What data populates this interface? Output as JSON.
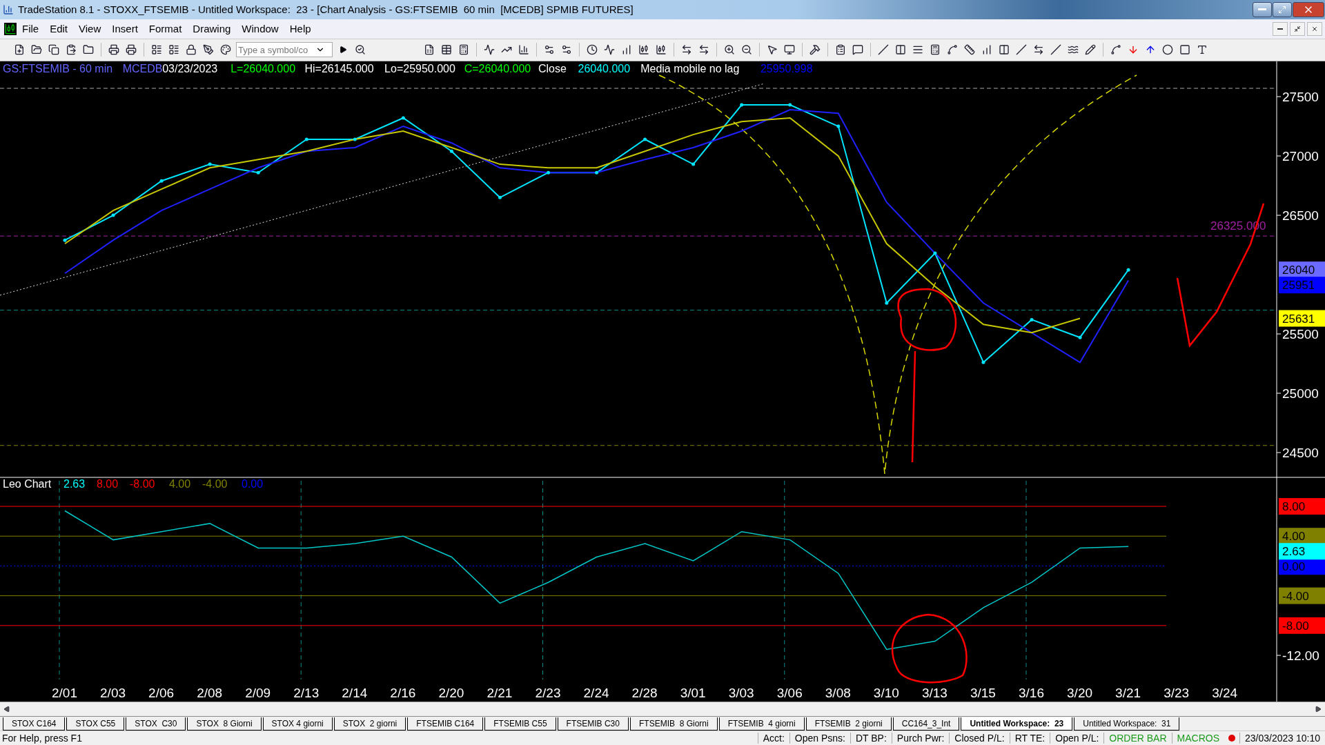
{
  "window": {
    "title": "TradeStation 8.1 - STOXX_FTSEMIB - Untitled Workspace:  23 - [Chart Analysis - GS:FTSEMIB  60 min  [MCEDB] SPMIB FUTURES]"
  },
  "menu": [
    "File",
    "Edit",
    "View",
    "Insert",
    "Format",
    "Drawing",
    "Window",
    "Help"
  ],
  "toolbar": {
    "symbol_field": {
      "placeholder": "Type a symbol/co"
    }
  },
  "chart": {
    "header": [
      {
        "text": "GS:FTSEMIB - 60 min",
        "color": "#6464ff"
      },
      {
        "text": "MCEDB",
        "color": "#6464ff"
      },
      {
        "text": "03/23/2023",
        "color": "#ffffff"
      },
      {
        "text": "L=26040.000",
        "color": "#00ff00"
      },
      {
        "text": "Hi=26145.000",
        "color": "#ffffff"
      },
      {
        "text": "Lo=25950.000",
        "color": "#ffffff"
      },
      {
        "text": "C=26040.000",
        "color": "#00ff00"
      },
      {
        "text": "Close",
        "color": "#ffffff"
      },
      {
        "text": "26040.000",
        "color": "#00ffff"
      },
      {
        "text": "Media mobile no lag",
        "color": "#ffffff"
      },
      {
        "text": "25950.998",
        "color": "#0000ff"
      }
    ],
    "price_panel": {
      "chart_data": {
        "type": "line",
        "ylim": [
          24291,
          27797
        ],
        "yticks": [
          24500,
          25000,
          25500,
          26500,
          27000,
          27500
        ],
        "series": [
          {
            "color": "#00e5ff",
            "values": [
              26290,
              26500,
              26790,
              26930,
              26860,
              27140,
              27140,
              27320,
              27040,
              26650,
              26860,
              26860,
              27140,
              26930,
              27430,
              27430,
              27250,
              25760,
              26180,
              25260,
              25620,
              25470,
              26040,
              null,
              null
            ]
          },
          {
            "color": "#2020ff",
            "values": [
              26010,
              26290,
              26540,
              26720,
              26900,
              27040,
              27070,
              27250,
              27110,
              26900,
              26860,
              26860,
              26970,
              27070,
              27210,
              27390,
              27360,
              26610,
              26180,
              25760,
              25510,
              25260,
              25951,
              null,
              null
            ]
          },
          {
            "color": "#c8c800",
            "values": [
              26260,
              26540,
              26720,
              26900,
              26970,
              27040,
              27140,
              27210,
              27070,
              26930,
              26900,
              26900,
              27040,
              27180,
              27290,
              27320,
              27000,
              26260,
              25900,
              25580,
              25510,
              25631,
              null,
              null,
              null
            ]
          }
        ],
        "ref_lines": [
          {
            "axis": "y",
            "value": 27570,
            "color": "#aaaaaa"
          },
          {
            "axis": "y",
            "value": 26325,
            "color": "#a020a0",
            "label": "26325.000"
          },
          {
            "axis": "y",
            "value": 25700,
            "color": "#0a8a8a"
          },
          {
            "axis": "y",
            "value": 24560,
            "color": "#808000"
          }
        ]
      },
      "value_tags": [
        {
          "text": "26040",
          "color": "#6b6bff"
        },
        {
          "text": "25951",
          "color": "#0000ff"
        },
        {
          "text": "25631",
          "color": "#ffff00"
        }
      ]
    },
    "indicator_panel": {
      "title": "Leo Chart",
      "values": [
        {
          "text": "2.63",
          "color": "#00ffff"
        },
        {
          "text": "8.00",
          "color": "#ff0000"
        },
        {
          "text": "-8.00",
          "color": "#ff0000"
        },
        {
          "text": "4.00",
          "color": "#808000"
        },
        {
          "text": "-4.00",
          "color": "#808000"
        },
        {
          "text": "0.00",
          "color": "#0000ff"
        }
      ],
      "chart_data": {
        "type": "line",
        "grid": true,
        "categories": [
          "2/01",
          "2/03",
          "2/06",
          "2/08",
          "2/09",
          "2/13",
          "2/14",
          "2/16",
          "2/20",
          "2/21",
          "2/23",
          "2/24",
          "2/28",
          "3/01",
          "3/03",
          "3/06",
          "3/08",
          "3/10",
          "3/13",
          "3/15",
          "3/16",
          "3/20",
          "3/21",
          "3/23",
          "3/24"
        ],
        "ylim": [
          -18.2,
          11.89
        ],
        "yticks": [
          {
            "value": 8,
            "label": "8.00"
          },
          {
            "value": 4,
            "label": "4.00"
          },
          {
            "value": 0,
            "label": "0.00"
          },
          {
            "value": -4,
            "label": "-4.00"
          },
          {
            "value": -8,
            "label": "-8.00"
          },
          {
            "value": -12,
            "label": "-12.00"
          }
        ],
        "series": [
          {
            "color": "#00c8c8",
            "values": [
              7.4,
              3.5,
              4.6,
              5.7,
              2.4,
              2.4,
              3.0,
              4.0,
              1.2,
              -5.0,
              -2.2,
              1.2,
              3.0,
              0.7,
              4.6,
              3.5,
              -1.0,
              -11.2,
              -10.1,
              -5.6,
              -2.2,
              2.4,
              2.6,
              null,
              null
            ]
          }
        ],
        "ref_lines": [
          {
            "axis": "y",
            "value": 8,
            "color": "#ff0000"
          },
          {
            "axis": "y",
            "value": 4,
            "color": "#808000"
          },
          {
            "axis": "y",
            "value": 0,
            "color": "#0000ff"
          },
          {
            "axis": "y",
            "value": -4,
            "color": "#808000"
          },
          {
            "axis": "y",
            "value": -8,
            "color": "#ff0000"
          }
        ]
      },
      "value_tags": [
        {
          "text": "2.63",
          "color": "#00ffff"
        }
      ]
    }
  },
  "workspace_tabs": [
    {
      "label": "STOX C164",
      "selected": false
    },
    {
      "label": "STOX C55",
      "selected": false
    },
    {
      "label": "STOX  C30",
      "selected": false
    },
    {
      "label": "STOX  8 Giorni",
      "selected": false
    },
    {
      "label": "STOX 4 giorni",
      "selected": false
    },
    {
      "label": "STOX  2 giorni",
      "selected": false
    },
    {
      "label": "FTSEMIB C164",
      "selected": false
    },
    {
      "label": "FTSEMIB C55",
      "selected": false
    },
    {
      "label": "FTSEMIB C30",
      "selected": false
    },
    {
      "label": "FTSEMIB  8 Giorni",
      "selected": false
    },
    {
      "label": "FTSEMIB  4 giorni",
      "selected": false
    },
    {
      "label": "FTSEMIB  2 giorni",
      "selected": false
    },
    {
      "label": "CC164_3_Int",
      "selected": false
    },
    {
      "label": "Untitled Workspace:  23",
      "selected": true
    },
    {
      "label": "Untitled Workspace:  31",
      "selected": false
    }
  ],
  "status_bar": {
    "help": "For Help, press F1",
    "fields": [
      {
        "text": "Acct:",
        "kind": "plain"
      },
      {
        "text": "Open Psns:",
        "kind": "plain"
      },
      {
        "text": "DT BP:",
        "kind": "plain"
      },
      {
        "text": "Purch Pwr:",
        "kind": "plain"
      },
      {
        "text": "Closed P/L:",
        "kind": "plain"
      },
      {
        "text": "RT TE:",
        "kind": "plain"
      },
      {
        "text": "Open P/L:",
        "kind": "plain"
      },
      {
        "text": "ORDER BAR",
        "kind": "link"
      },
      {
        "text": "MACROS",
        "kind": "link"
      },
      {
        "kind": "dot",
        "color": "#e00000"
      },
      {
        "text": "23/03/2023 10:10",
        "kind": "plain"
      }
    ]
  }
}
